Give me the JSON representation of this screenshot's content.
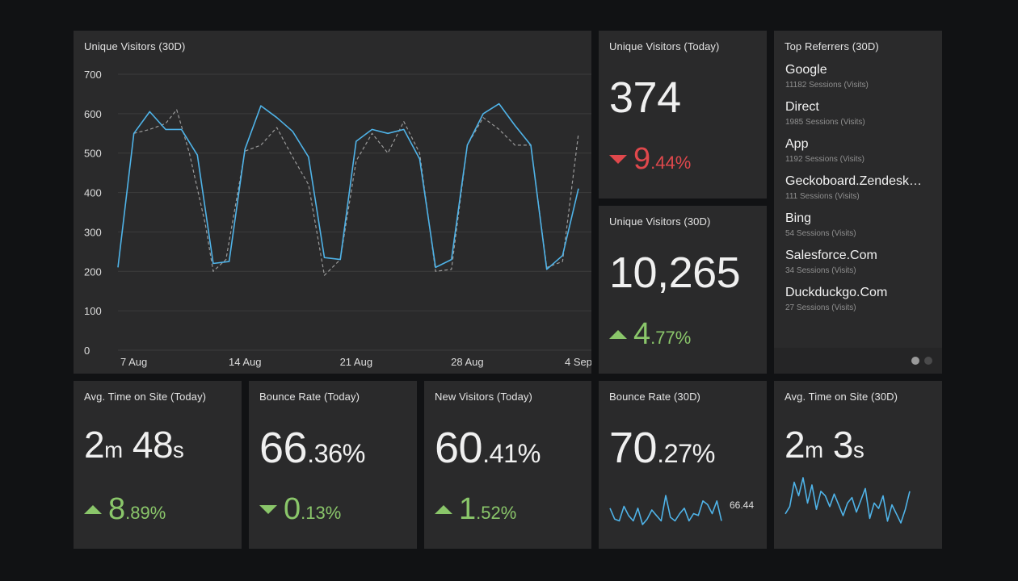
{
  "main_chart": {
    "title": "Unique Visitors (30D)",
    "chart_data": {
      "type": "line",
      "title": "Unique Visitors (30D)",
      "ylim": [
        0,
        700
      ],
      "y_ticks": [
        0,
        100,
        200,
        300,
        400,
        500,
        600,
        700
      ],
      "x_tick_labels": [
        "7 Aug",
        "14 Aug",
        "21 Aug",
        "28 Aug",
        "4 Sep"
      ],
      "x_tick_days": [
        1,
        8,
        15,
        22,
        29
      ],
      "x_range": [
        0,
        29
      ],
      "grid": true,
      "series": [
        {
          "color": "#4fb3e8",
          "style": "solid",
          "values": [
            [
              0,
              210
            ],
            [
              1,
              550
            ],
            [
              2,
              605
            ],
            [
              3,
              560
            ],
            [
              4,
              560
            ],
            [
              5,
              495
            ],
            [
              6,
              220
            ],
            [
              7,
              225
            ],
            [
              8,
              510
            ],
            [
              9,
              620
            ],
            [
              10,
              590
            ],
            [
              11,
              555
            ],
            [
              12,
              490
            ],
            [
              13,
              235
            ],
            [
              14,
              230
            ],
            [
              15,
              530
            ],
            [
              16,
              560
            ],
            [
              17,
              550
            ],
            [
              18,
              560
            ],
            [
              19,
              485
            ],
            [
              20,
              210
            ],
            [
              21,
              230
            ],
            [
              22,
              520
            ],
            [
              23,
              600
            ],
            [
              24,
              625
            ],
            [
              25,
              570
            ],
            [
              26,
              520
            ],
            [
              27,
              205
            ],
            [
              28,
              240
            ],
            [
              29,
              410
            ]
          ]
        },
        {
          "color": "#9a9a9a",
          "style": "dashed",
          "values": [
            [
              1,
              550
            ],
            [
              2,
              560
            ],
            [
              3,
              575
            ],
            [
              3.7,
              610
            ],
            [
              4.5,
              500
            ],
            [
              5.5,
              320
            ],
            [
              6,
              200
            ],
            [
              6.8,
              230
            ],
            [
              8,
              505
            ],
            [
              9,
              520
            ],
            [
              10,
              565
            ],
            [
              11,
              490
            ],
            [
              12,
              420
            ],
            [
              13,
              190
            ],
            [
              14,
              230
            ],
            [
              15,
              480
            ],
            [
              16,
              550
            ],
            [
              17,
              500
            ],
            [
              18,
              580
            ],
            [
              19,
              500
            ],
            [
              20,
              200
            ],
            [
              21,
              205
            ],
            [
              22,
              520
            ],
            [
              23,
              590
            ],
            [
              24,
              560
            ],
            [
              25,
              520
            ],
            [
              26,
              520
            ],
            [
              27,
              210
            ],
            [
              28,
              225
            ],
            [
              29,
              550
            ]
          ]
        }
      ]
    }
  },
  "visitors_today": {
    "title": "Unique Visitors (Today)",
    "value": "374",
    "delta_main": "9",
    "delta_sub": ".44%",
    "direction": "down"
  },
  "visitors_30d": {
    "title": "Unique Visitors (30D)",
    "value": "10,265",
    "delta_main": "4",
    "delta_sub": ".77%",
    "direction": "up"
  },
  "referrers": {
    "title": "Top Referrers (30D)",
    "items": [
      {
        "name": "Google",
        "sub": "11182 Sessions (Visits)"
      },
      {
        "name": "Direct",
        "sub": "1985 Sessions (Visits)"
      },
      {
        "name": "App",
        "sub": "1192 Sessions (Visits)"
      },
      {
        "name": "Geckoboard.Zendesk…",
        "sub": "111 Sessions (Visits)"
      },
      {
        "name": "Bing",
        "sub": "54 Sessions (Visits)"
      },
      {
        "name": "Salesforce.Com",
        "sub": "34 Sessions (Visits)"
      },
      {
        "name": "Duckduckgo.Com",
        "sub": "27 Sessions (Visits)"
      }
    ],
    "pages": 2,
    "active_page": 1
  },
  "avg_time_today": {
    "title": "Avg. Time on Site (Today)",
    "v1": "2",
    "u1": "m",
    "v2": "48",
    "u2": "s",
    "delta_main": "8",
    "delta_sub": ".89%",
    "direction": "up"
  },
  "bounce_today": {
    "title": "Bounce Rate (Today)",
    "value_main": "66",
    "value_sub": ".36%",
    "delta_main": "0",
    "delta_sub": ".13%",
    "direction": "down-good"
  },
  "new_visitors_today": {
    "title": "New Visitors (Today)",
    "value_main": "60",
    "value_sub": ".41%",
    "delta_main": "1",
    "delta_sub": ".52%",
    "direction": "up"
  },
  "bounce_30d": {
    "title": "Bounce Rate (30D)",
    "value_main": "70",
    "value_sub": ".27%",
    "spark_label": "66.44",
    "sparkline": [
      70,
      64,
      63,
      71,
      66,
      63,
      70,
      61,
      64,
      69,
      66,
      63,
      77,
      65,
      63,
      67,
      70,
      63,
      67,
      66,
      74,
      72,
      67,
      74,
      63
    ]
  },
  "avg_time_30d": {
    "title": "Avg. Time on Site (30D)",
    "v1": "2",
    "u1": "m",
    "v2": "3",
    "u2": "s",
    "sparkline": [
      130,
      138,
      165,
      150,
      170,
      142,
      162,
      135,
      155,
      150,
      138,
      152,
      140,
      128,
      142,
      148,
      132,
      145,
      158,
      125,
      142,
      136,
      150,
      122,
      140,
      130,
      120,
      135,
      155
    ]
  }
}
